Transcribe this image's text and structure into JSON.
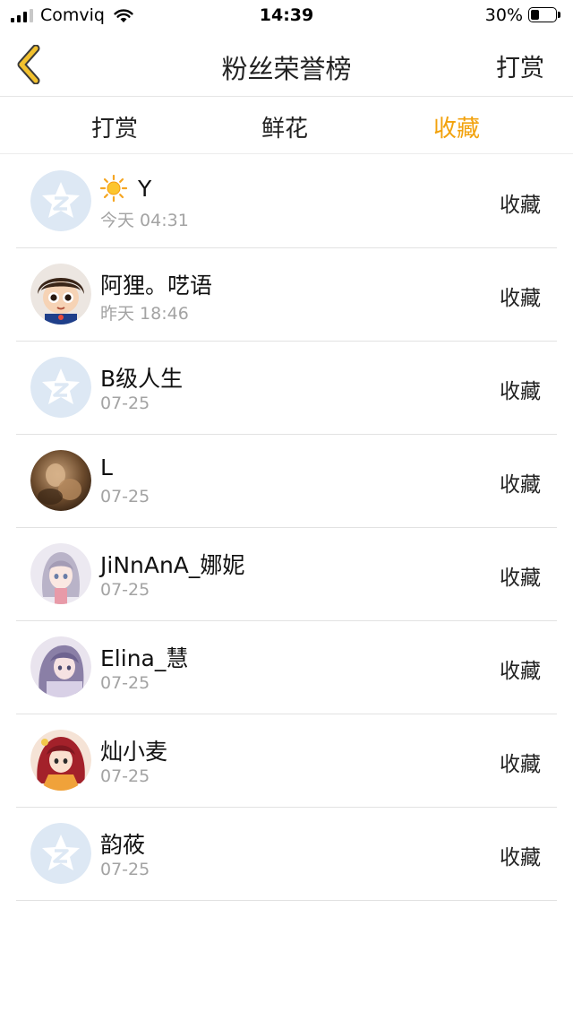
{
  "status_bar": {
    "carrier": "Comviq",
    "time": "14:39",
    "battery_percent": "30%",
    "battery_level": 0.3
  },
  "nav": {
    "title": "粉丝荣誉榜",
    "right_label": "打赏",
    "back_icon": "chevron-left-icon",
    "accent_color": "#f2c12e"
  },
  "tabs": [
    {
      "label": "打赏",
      "active": false
    },
    {
      "label": "鲜花",
      "active": false
    },
    {
      "label": "收藏",
      "active": true
    }
  ],
  "tab_active_color": "#f2a20d",
  "fans": [
    {
      "name": "Y",
      "time": "今天 04:31",
      "action": "收藏",
      "avatar": "default-avatar-icon",
      "emoji": "sun-icon"
    },
    {
      "name": "阿狸。呓语",
      "time": "昨天 18:46",
      "action": "收藏",
      "avatar": "cartoon-boy-avatar"
    },
    {
      "name": "B级人生",
      "time": "07-25",
      "action": "收藏",
      "avatar": "default-avatar-icon"
    },
    {
      "name": "L",
      "time": "07-25",
      "action": "收藏",
      "avatar": "photo-avatar"
    },
    {
      "name": "JiNnAnA_娜妮",
      "time": "07-25",
      "action": "收藏",
      "avatar": "anime-avatar"
    },
    {
      "name": "Elina_慧",
      "time": "07-25",
      "action": "收藏",
      "avatar": "anime-avatar"
    },
    {
      "name": "灿小麦",
      "time": "07-25",
      "action": "收藏",
      "avatar": "anime-avatar"
    },
    {
      "name": "韵莜",
      "time": "07-25",
      "action": "收藏",
      "avatar": "default-avatar-icon"
    }
  ]
}
